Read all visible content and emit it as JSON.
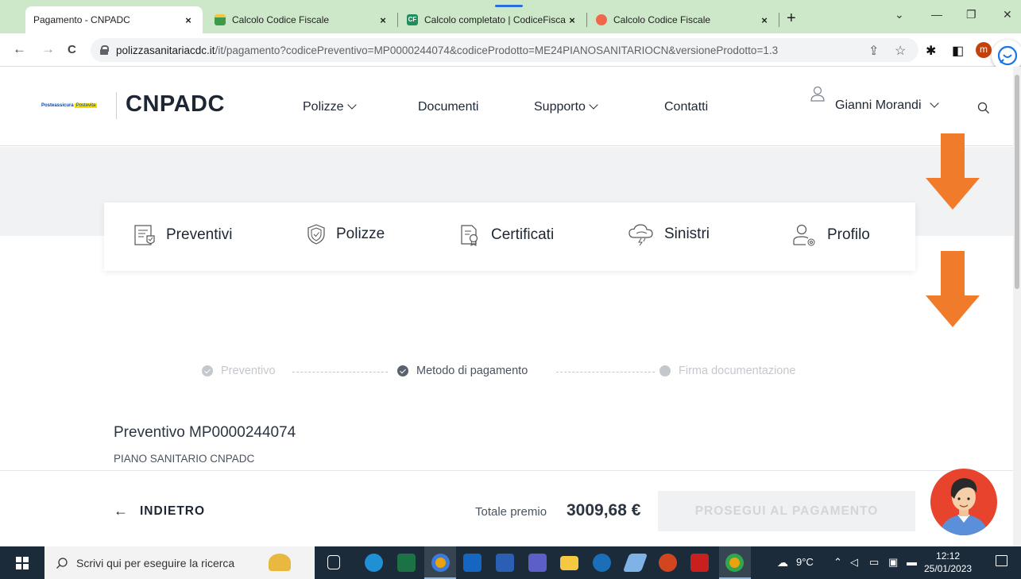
{
  "browser": {
    "tabs": [
      {
        "title": "Pagamento - CNPADC",
        "active": true
      },
      {
        "title": "Calcolo Codice Fiscale",
        "active": false
      },
      {
        "title": "Calcolo completato | CodiceFisca",
        "active": false
      },
      {
        "title": "Calcolo Codice Fiscale",
        "active": false
      }
    ],
    "tab_close": "×",
    "new_tab": "+",
    "url_host": "polizzasanitariacdc.it",
    "url_path": "/it/pagamento?codicePreventivo=MP0000244074&codiceProdotto=ME24PIANOSANITARIOCN&versioneProdotto=1.3",
    "profile_initial": "m",
    "window_controls": {
      "minimize": "—",
      "restore": "❐",
      "close": "✕",
      "dropdown": "⌄"
    },
    "nav": {
      "back": "←",
      "forward": "→",
      "reload": "C"
    }
  },
  "header": {
    "logo_text_a": "Posteassicura",
    "logo_text_b": "Postevita",
    "brand": "CNPADC",
    "menu": [
      {
        "label": "Polizze",
        "dropdown": true
      },
      {
        "label": "Documenti",
        "dropdown": false
      },
      {
        "label": "Supporto",
        "dropdown": true
      },
      {
        "label": "Contatti",
        "dropdown": false
      }
    ],
    "user_name": "Gianni Morandi"
  },
  "quick_nav": [
    {
      "label": "Preventivi",
      "icon": "quote-document-icon"
    },
    {
      "label": "Polizze",
      "icon": "shield-icon"
    },
    {
      "label": "Certificati",
      "icon": "certificate-icon"
    },
    {
      "label": "Sinistri",
      "icon": "storm-cloud-icon"
    },
    {
      "label": "Profilo",
      "icon": "user-settings-icon"
    }
  ],
  "stepper": {
    "steps": [
      {
        "label": "Preventivo",
        "state": "done"
      },
      {
        "label": "Metodo di pagamento",
        "state": "current"
      },
      {
        "label": "Firma documentazione",
        "state": "pending"
      }
    ]
  },
  "quote": {
    "title": "Preventivo MP0000244074",
    "product": "PIANO SANITARIO CNPADC"
  },
  "footer": {
    "back_arrow": "←",
    "back_label": "INDIETRO",
    "total_label": "Totale premio",
    "total_value": "3009,68 €",
    "pay_label": "PROSEGUI AL PAGAMENTO"
  },
  "taskbar": {
    "search_placeholder": "Scrivi qui per eseguire la ricerca",
    "weather": "9°C",
    "time": "12:12",
    "date": "25/01/2023"
  },
  "colors": {
    "tabbar": "#cde8c9",
    "arrow": "#f07b2a",
    "brand_text": "#1d2733",
    "taskbar": "#1c2b3a"
  }
}
